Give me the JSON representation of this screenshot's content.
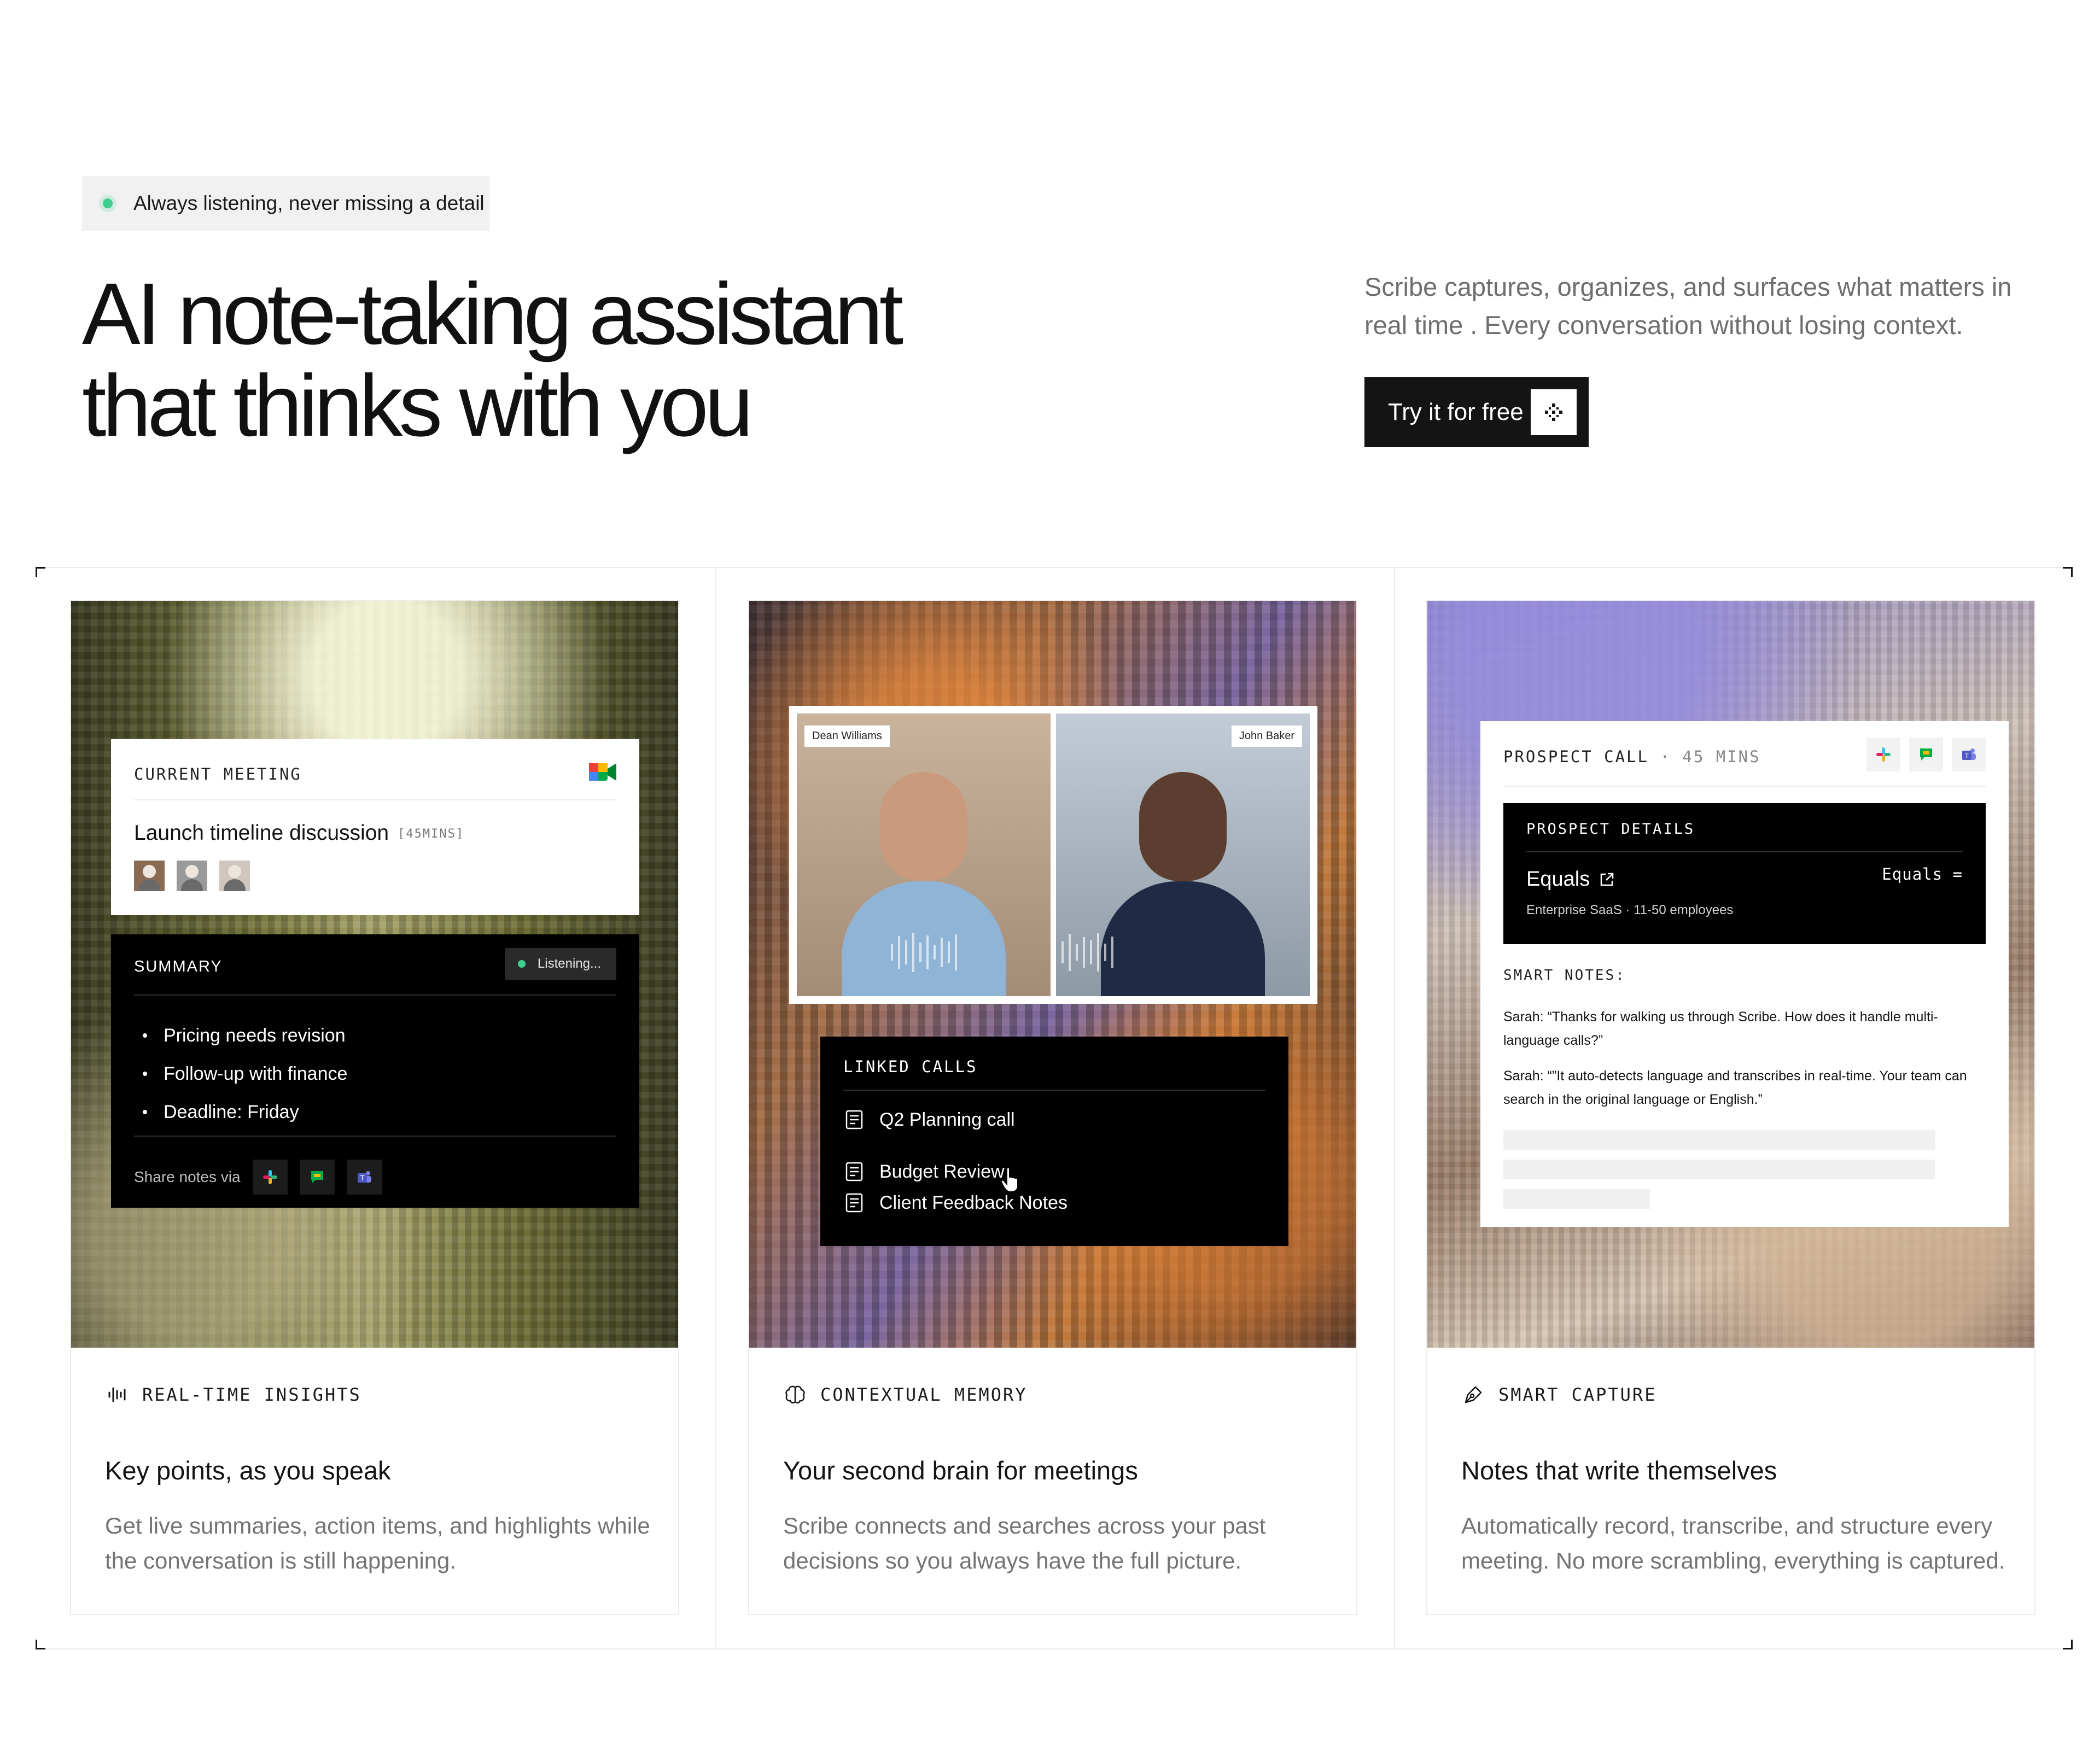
{
  "hero": {
    "pill_text": "Always listening, never missing a detail",
    "title_line1": "AI note-taking assistant",
    "title_line2": "that thinks with you",
    "description": "Scribe captures, organizes, and surfaces what matters in real time . Every conversation without losing context.",
    "cta_label": "Try it for free"
  },
  "cards": [
    {
      "tag": "REAL-TIME INSIGHTS",
      "title": "Key points, as you speak",
      "description": "Get live summaries, action items, and highlights while the conversation is still happening.",
      "meeting": {
        "label": "CURRENT MEETING",
        "title": "Launch timeline discussion",
        "duration": "[45MINS]"
      },
      "summary": {
        "label": "SUMMARY",
        "status": "Listening...",
        "items": [
          "Pricing needs revision",
          "Follow-up with finance",
          "Deadline: Friday"
        ],
        "share_label": "Share notes via"
      }
    },
    {
      "tag": "CONTEXTUAL MEMORY",
      "title": "Your second brain for meetings",
      "description": "Scribe connects and searches across your past decisions so you always have the full picture.",
      "participants": [
        "Dean Williams",
        "John Baker"
      ],
      "linked": {
        "label": "LINKED CALLS",
        "calls": [
          "Q2 Planning call",
          "Budget Review",
          "Client Feedback Notes"
        ]
      }
    },
    {
      "tag": "SMART CAPTURE",
      "title": "Notes that write themselves",
      "description": "Automatically record, transcribe, and structure every meeting. No more scrambling, everything is captured.",
      "prospect": {
        "label": "PROSPECT CALL",
        "duration": "· 45 MINS",
        "details_label": "PROSPECT DETAILS",
        "company": "Equals",
        "company_tag": "Equals =",
        "company_sub": "Enterprise SaaS · 11-50 employees",
        "notes_label": "SMART NOTES:",
        "quote1": "Sarah: “Thanks for walking us through Scribe. How does it handle multi-language calls?”",
        "quote2": "Sarah: “”It auto-detects language and transcribes in real-time. Your team can search in the original language or English.”"
      }
    }
  ],
  "colors": {
    "accent_green": "#3ecf8e",
    "text_dark": "#141414",
    "text_muted": "#737373"
  }
}
